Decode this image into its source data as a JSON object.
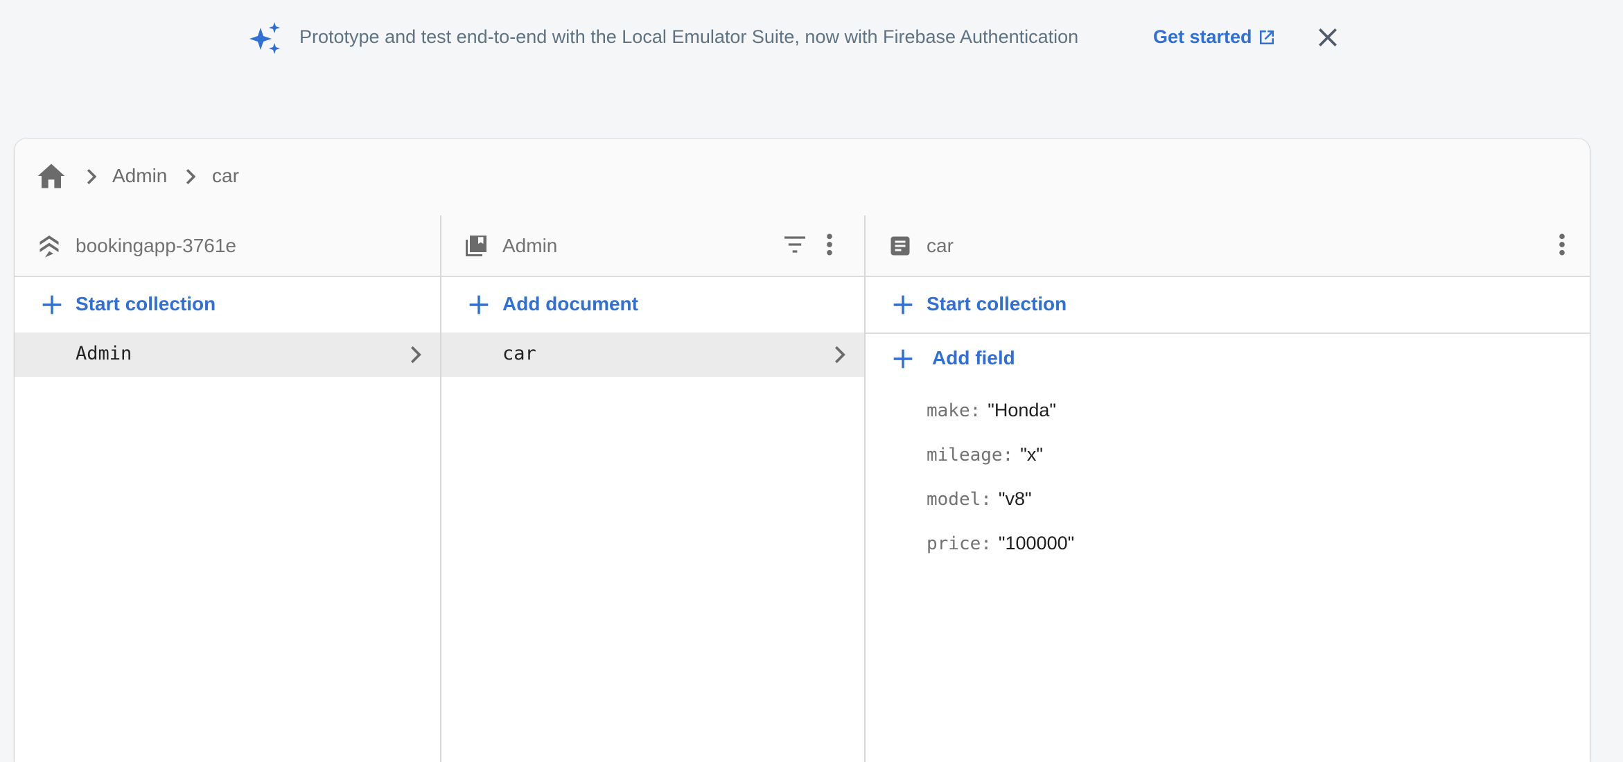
{
  "banner": {
    "icon": "sparkle-icon",
    "message": "Prototype and test end-to-end with the Local Emulator Suite, now with Firebase Authentication",
    "cta_label": "Get started",
    "cta_icon": "open-in-new-icon",
    "close_icon": "close-icon"
  },
  "colors": {
    "accent": "#2f6fd6",
    "banner_text": "#5f7282",
    "icon_gray": "#6b6b6b",
    "selected_row": "#ebebeb"
  },
  "breadcrumb": {
    "home_icon": "home-icon",
    "items": [
      "Admin",
      "car"
    ]
  },
  "columns": [
    {
      "icon": "database-stack-icon",
      "title": "bookingapp-3761e",
      "action_label": "Start collection",
      "items": [
        {
          "label": "Admin",
          "selected": true
        }
      ]
    },
    {
      "icon": "collection-icon",
      "title": "Admin",
      "action_label": "Add document",
      "header_buttons": [
        "filter-icon",
        "more-vert-icon"
      ],
      "items": [
        {
          "label": "car",
          "selected": true
        }
      ]
    },
    {
      "icon": "document-icon",
      "title": "car",
      "action_label": "Start collection",
      "header_buttons": [
        "more-vert-icon"
      ],
      "add_field_label": "Add field",
      "fields": [
        {
          "key": "make:",
          "value": "\"Honda\""
        },
        {
          "key": "mileage:",
          "value": "\"x\""
        },
        {
          "key": "model:",
          "value": "\"v8\""
        },
        {
          "key": "price:",
          "value": "\"100000\""
        }
      ]
    }
  ]
}
